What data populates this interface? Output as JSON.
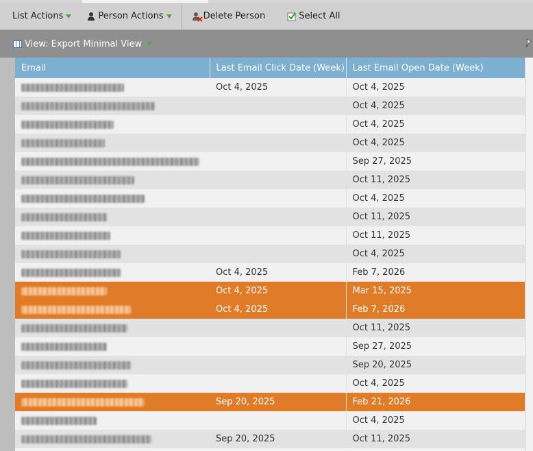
{
  "toolbar": {
    "list_actions": "List Actions",
    "person_actions": "Person Actions",
    "delete_person": "Delete Person",
    "select_all": "Select All"
  },
  "view": {
    "label": "View: Export Minimal View"
  },
  "columns": [
    "Email",
    "Last Email Click Date (Week)",
    "Last Email Open Date (Week)"
  ],
  "rows": [
    {
      "click": "Oct 4, 2025",
      "open": "Oct 4, 2025",
      "selected": false
    },
    {
      "click": "",
      "open": "Oct 4, 2025",
      "selected": false
    },
    {
      "click": "",
      "open": "Oct 4, 2025",
      "selected": false
    },
    {
      "click": "",
      "open": "Oct 4, 2025",
      "selected": false
    },
    {
      "click": "",
      "open": "Sep 27, 2025",
      "selected": false
    },
    {
      "click": "",
      "open": "Oct 11, 2025",
      "selected": false
    },
    {
      "click": "",
      "open": "Oct 4, 2025",
      "selected": false
    },
    {
      "click": "",
      "open": "Oct 11, 2025",
      "selected": false
    },
    {
      "click": "",
      "open": "Oct 11, 2025",
      "selected": false
    },
    {
      "click": "",
      "open": "Oct 4, 2025",
      "selected": false
    },
    {
      "click": "Oct 4, 2025",
      "open": "Feb 7, 2026",
      "selected": false
    },
    {
      "click": "Oct 4, 2025",
      "open": "Mar 15, 2025",
      "selected": true
    },
    {
      "click": "Oct 4, 2025",
      "open": "Feb 7, 2026",
      "selected": true
    },
    {
      "click": "",
      "open": "Oct 11, 2025",
      "selected": false
    },
    {
      "click": "",
      "open": "Sep 27, 2025",
      "selected": false
    },
    {
      "click": "",
      "open": "Sep 20, 2025",
      "selected": false
    },
    {
      "click": "",
      "open": "Oct 4, 2025",
      "selected": false
    },
    {
      "click": "Sep 20, 2025",
      "open": "Feb 21, 2026",
      "selected": true
    },
    {
      "click": "",
      "open": "Oct 4, 2025",
      "selected": false
    },
    {
      "click": "Sep 20, 2025",
      "open": "Oct 11, 2025",
      "selected": false
    }
  ],
  "colors": {
    "header": "#7dafd0",
    "selected_row": "#e07b28",
    "caret": "#4fa83d"
  },
  "icons": [
    "caret-down-icon",
    "person-icon",
    "delete-person-icon",
    "select-all-check-icon",
    "grid-view-icon",
    "pin-icon"
  ]
}
